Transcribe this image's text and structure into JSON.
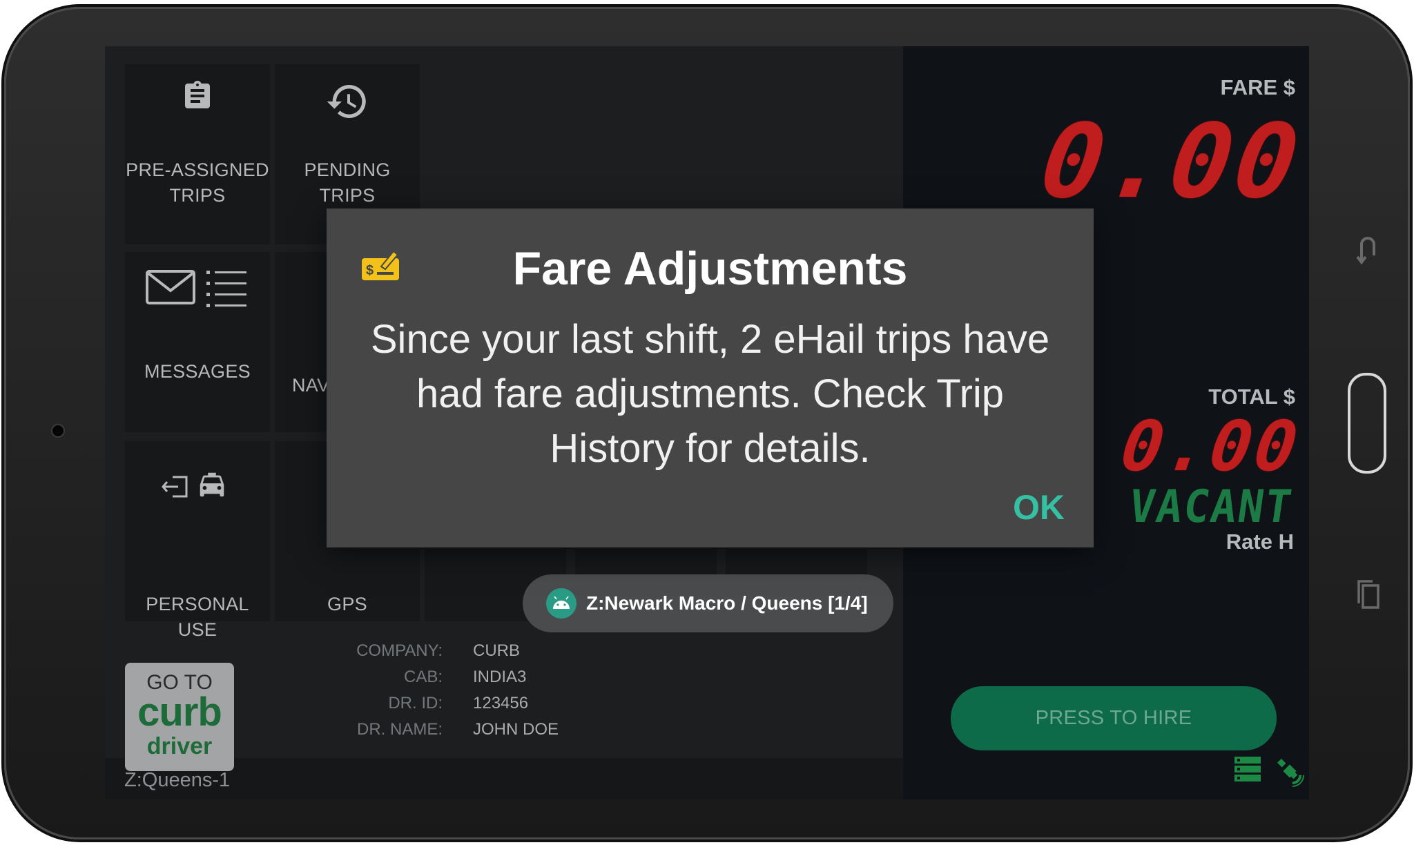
{
  "tiles": {
    "pre_assigned": "PRE-ASSIGNED\nTRIPS",
    "pending": "PENDING\nTRIPS",
    "messages": "MESSAGES",
    "navigation_partial": "NAV",
    "personal_use": "PERSONAL USE",
    "gps": "GPS"
  },
  "meter": {
    "fare_label": "FARE $",
    "fare_value": "0.00",
    "total_label": "TOTAL $",
    "total_value": "0.00",
    "status": "VACANT",
    "rate": "Rate H",
    "hire_button": "PRESS TO HIRE"
  },
  "driver_info": {
    "company_key": "COMPANY:",
    "company_val": "CURB",
    "cab_key": "CAB:",
    "cab_val": "INDIA3",
    "id_key": "DR. ID:",
    "id_val": "123456",
    "name_key": "DR. NAME:",
    "name_val": "JOHN DOE"
  },
  "curb_button": {
    "line1": "GO TO",
    "brand": "curb",
    "line3": "driver"
  },
  "zone": "Z:Queens-1",
  "dialog": {
    "title": "Fare Adjustments",
    "message": "Since your last shift, 2 eHail trips have had fare adjustments. Check Trip History for details.",
    "ok": "OK"
  },
  "toast": "Z:Newark Macro / Queens [1/4]",
  "colors": {
    "meter_red": "#c01e1e",
    "vacant_green": "#1c7a44",
    "ok_teal": "#35c0a3",
    "hire_green": "#0e6b49",
    "curb_green": "#1e6b3a",
    "dialog_icon_yellow": "#f2c21b"
  },
  "icons": [
    "clipboard-icon",
    "history-icon",
    "envelope-icon",
    "list-icon",
    "exit-icon",
    "taxi-icon",
    "check-dollar-icon",
    "android-icon",
    "server-icon",
    "satellite-icon",
    "back-icon",
    "home-icon",
    "recents-icon"
  ]
}
